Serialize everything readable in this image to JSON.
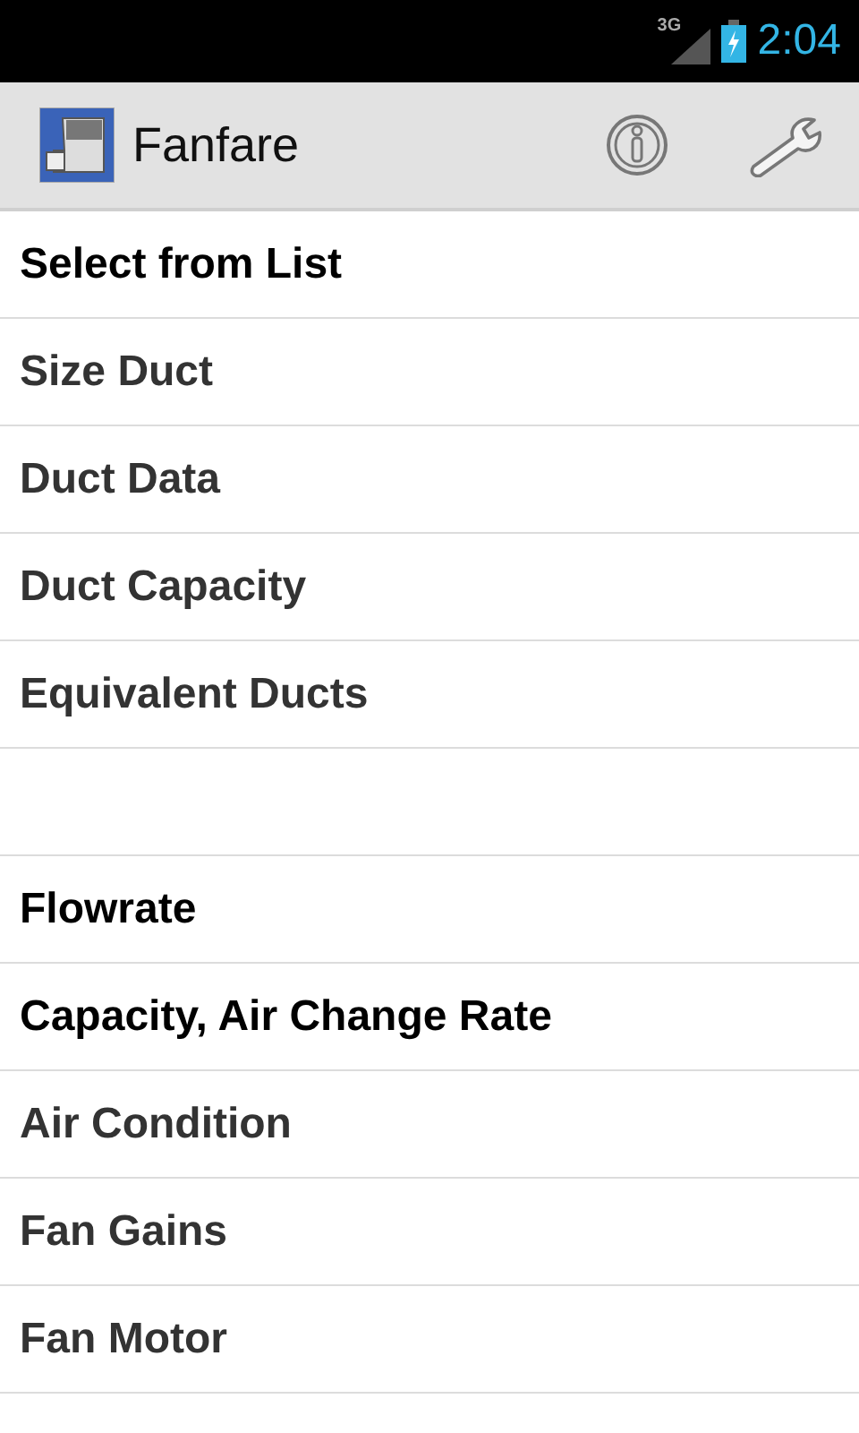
{
  "status_bar": {
    "network": "3G",
    "time": "2:04"
  },
  "action_bar": {
    "title": "Fanfare"
  },
  "list": [
    {
      "kind": "item",
      "label": "Select from List",
      "emphasized": true
    },
    {
      "kind": "item",
      "label": "Size Duct",
      "emphasized": false
    },
    {
      "kind": "item",
      "label": "Duct Data",
      "emphasized": false
    },
    {
      "kind": "item",
      "label": "Duct Capacity",
      "emphasized": false
    },
    {
      "kind": "item",
      "label": "Equivalent Ducts",
      "emphasized": false
    },
    {
      "kind": "spacer"
    },
    {
      "kind": "item",
      "label": "Flowrate",
      "emphasized": true
    },
    {
      "kind": "item",
      "label": "Capacity, Air Change Rate",
      "emphasized": true
    },
    {
      "kind": "item",
      "label": "Air Condition",
      "emphasized": false
    },
    {
      "kind": "item",
      "label": "Fan Gains",
      "emphasized": false
    },
    {
      "kind": "item",
      "label": "Fan Motor",
      "emphasized": false
    }
  ]
}
